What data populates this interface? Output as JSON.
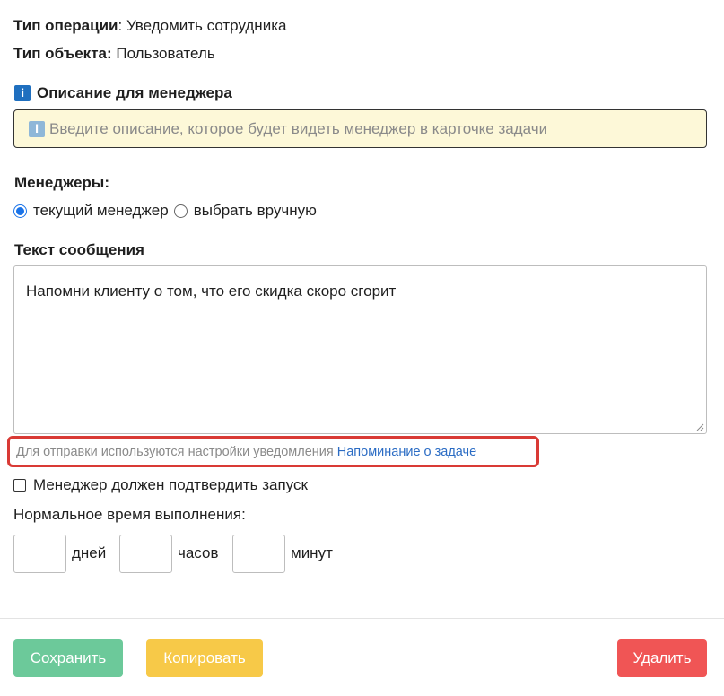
{
  "operation": {
    "type_label": "Тип операции",
    "type_value": "Уведомить сотрудника",
    "object_label": "Тип объекта:",
    "object_value": "Пользователь"
  },
  "description": {
    "heading": "Описание для менеджера",
    "placeholder": "Введите описание, которое будет видеть менеджер в карточке задачи",
    "icon": "info-icon"
  },
  "managers": {
    "label": "Менеджеры:",
    "options": [
      {
        "label": "текущий менеджер",
        "checked": true
      },
      {
        "label": "выбрать вручную",
        "checked": false
      }
    ]
  },
  "message": {
    "label": "Текст сообщения",
    "value": "Напомни клиенту о том, что его скидка скоро сгорит"
  },
  "notification": {
    "text": "Для отправки используются настройки уведомления",
    "link": "Напоминание о задаче",
    "highlight_color": "#d93a35"
  },
  "confirm": {
    "label": "Менеджер должен подтвердить запуск",
    "checked": false
  },
  "normal_time": {
    "label": "Нормальное время выполнения:",
    "units": [
      "дней",
      "часов",
      "минут"
    ]
  },
  "buttons": {
    "save": "Сохранить",
    "copy": "Копировать",
    "delete": "Удалить"
  },
  "colors": {
    "save": "#6cc99a",
    "copy": "#f7c948",
    "delete": "#f05555",
    "accent": "#1a73e8",
    "link": "#2b6cc4"
  }
}
